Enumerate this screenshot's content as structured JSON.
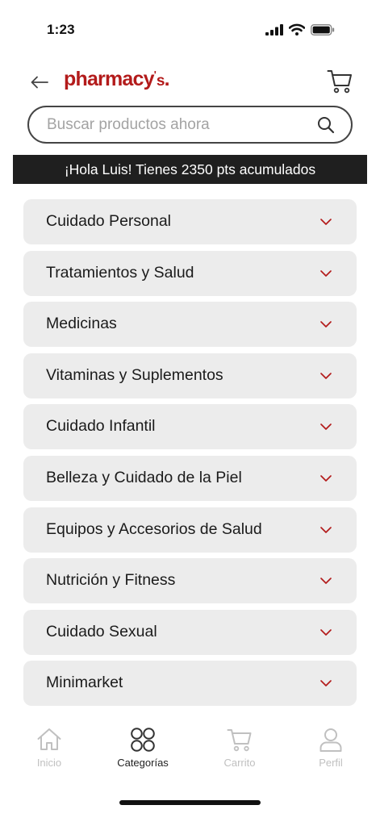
{
  "status_bar": {
    "time": "1:23"
  },
  "header": {
    "logo_main": "pharmacy",
    "logo_apostrophe": "'",
    "logo_s": "s",
    "logo_dot": "."
  },
  "search": {
    "placeholder": "Buscar productos ahora"
  },
  "banner": {
    "text": "¡Hola Luis! Tienes 2350 pts acumulados"
  },
  "categories": [
    {
      "label": "Cuidado Personal"
    },
    {
      "label": "Tratamientos y Salud"
    },
    {
      "label": "Medicinas"
    },
    {
      "label": "Vitaminas y Suplementos"
    },
    {
      "label": "Cuidado Infantil"
    },
    {
      "label": "Belleza y Cuidado de la Piel"
    },
    {
      "label": "Equipos y Accesorios de Salud"
    },
    {
      "label": "Nutrición y Fitness"
    },
    {
      "label": "Cuidado Sexual"
    },
    {
      "label": "Minimarket"
    }
  ],
  "tabbar": {
    "items": [
      {
        "label": "Inicio",
        "icon": "home-icon",
        "active": false
      },
      {
        "label": "Categorías",
        "icon": "categories-icon",
        "active": true
      },
      {
        "label": "Carrito",
        "icon": "cart-icon",
        "active": false
      },
      {
        "label": "Perfil",
        "icon": "profile-icon",
        "active": false
      }
    ]
  },
  "colors": {
    "brand_red": "#b31b1b",
    "banner_bg": "#1f1f1f",
    "category_bg": "#ececec",
    "inactive_tab": "#c0c0c0"
  }
}
